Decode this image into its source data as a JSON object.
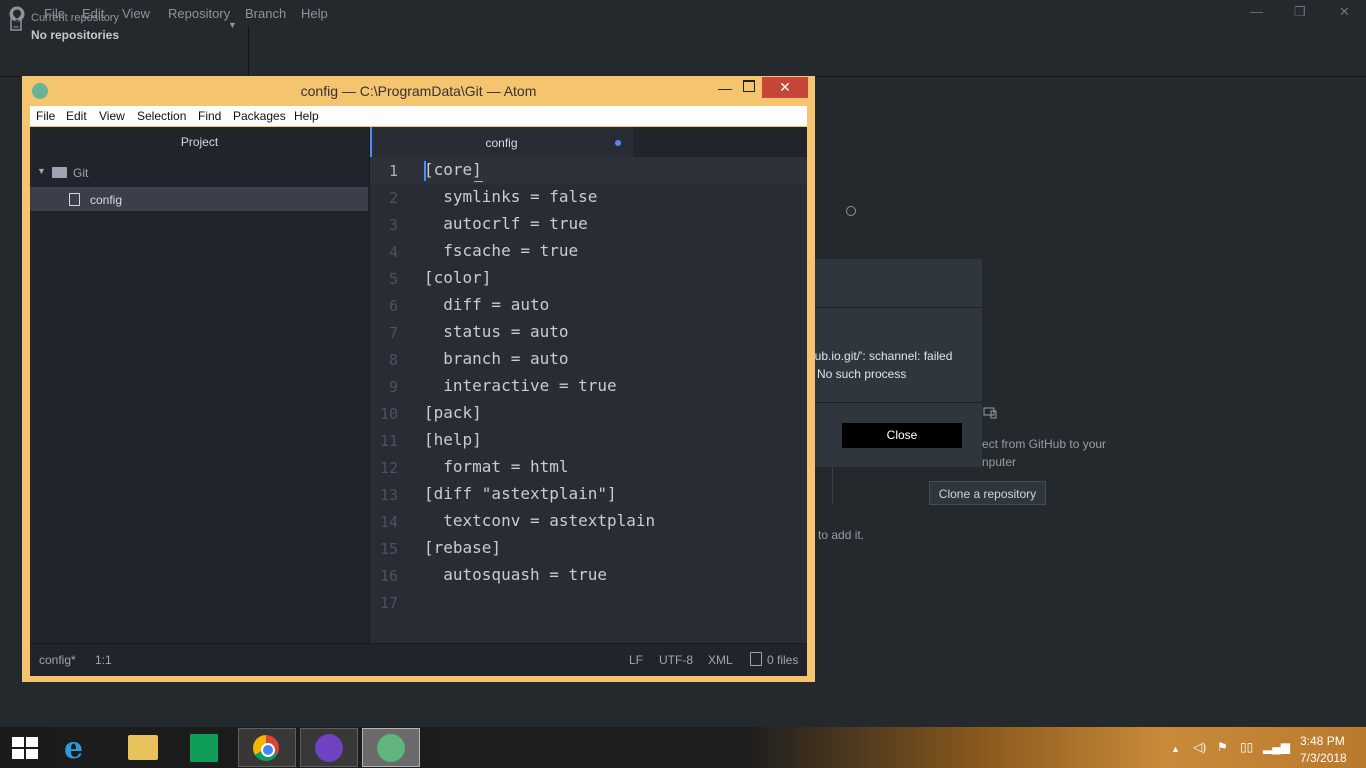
{
  "github_desktop": {
    "menu": [
      "File",
      "Edit",
      "View",
      "Repository",
      "Branch",
      "Help"
    ],
    "window_controls": {
      "minimize": "—",
      "restore": "❐",
      "close": "✕"
    },
    "repo_selector": {
      "caption": "Current repository",
      "value": "No repositories"
    },
    "error_dialog": {
      "message_line1": "hub.io.git/': schannel: failed",
      "message_line2": "': No such process",
      "close_label": "Close"
    },
    "clone_panel": {
      "text_line1": "ect from GitHub to your",
      "text_line2": "nputer",
      "button_label": "Clone a repository"
    },
    "add_hint": "to add it."
  },
  "atom": {
    "title": "config — C:\\ProgramData\\Git — Atom",
    "controls": {
      "minimize": "—",
      "close": "✕"
    },
    "menu": [
      "File",
      "Edit",
      "View",
      "Selection",
      "Find",
      "Packages",
      "Help"
    ],
    "tree": {
      "header": "Project",
      "folder": "Git",
      "file": "config"
    },
    "tab": {
      "label": "config",
      "modified": true
    },
    "code_lines": [
      "[core]",
      "  symlinks = false",
      "  autocrlf = true",
      "  fscache = true",
      "[color]",
      "  diff = auto",
      "  status = auto",
      "  branch = auto",
      "  interactive = true",
      "[pack]",
      "[help]",
      "  format = html",
      "[diff \"astextplain\"]",
      "  textconv = astextplain",
      "[rebase]",
      "  autosquash = true",
      ""
    ],
    "line_numbers": [
      "1",
      "2",
      "3",
      "4",
      "5",
      "6",
      "7",
      "8",
      "9",
      "10",
      "11",
      "12",
      "13",
      "14",
      "15",
      "16",
      "17"
    ],
    "status_bar": {
      "file": "config*",
      "cursor": "1:1",
      "line_ending": "LF",
      "encoding": "UTF-8",
      "grammar": "XML",
      "files": "0 files"
    }
  },
  "taskbar": {
    "clock_time": "3:48 PM",
    "clock_date": "7/3/2018",
    "tray_icons": [
      "chevron-up-icon",
      "speaker-icon",
      "flag-icon",
      "network-icon",
      "signal-icon"
    ]
  },
  "colors": {
    "atom_frame": "#f5c46f",
    "atom_close": "#c7463a",
    "accent_blue": "#568af2",
    "editor_bg": "#282c34"
  }
}
